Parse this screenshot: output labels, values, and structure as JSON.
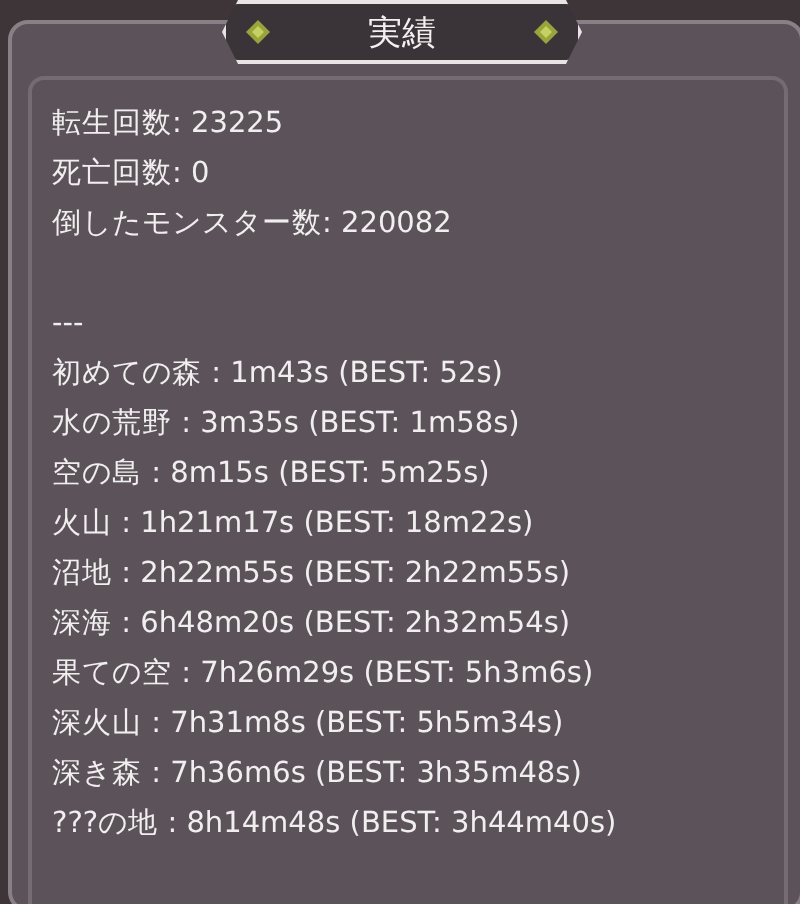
{
  "window": {
    "title": "実績"
  },
  "stats": [
    "転生回数: 23225",
    "死亡回数: 0",
    "倒したモンスター数: 220082"
  ],
  "separator": "---",
  "records": [
    "初めての森 : 1m43s (BEST: 52s)",
    "水の荒野 : 3m35s (BEST: 1m58s)",
    "空の島 : 8m15s (BEST: 5m25s)",
    "火山 : 1h21m17s (BEST: 18m22s)",
    "沼地 : 2h22m55s (BEST: 2h22m55s)",
    "深海 : 6h48m20s (BEST: 2h32m54s)",
    "果ての空 : 7h26m29s (BEST: 5h3m6s)",
    "深火山 : 7h31m8s (BEST: 5h5m34s)",
    "深き森 : 7h36m6s (BEST: 3h35m48s)",
    "???の地 : 8h14m48s (BEST: 3h44m40s)"
  ]
}
